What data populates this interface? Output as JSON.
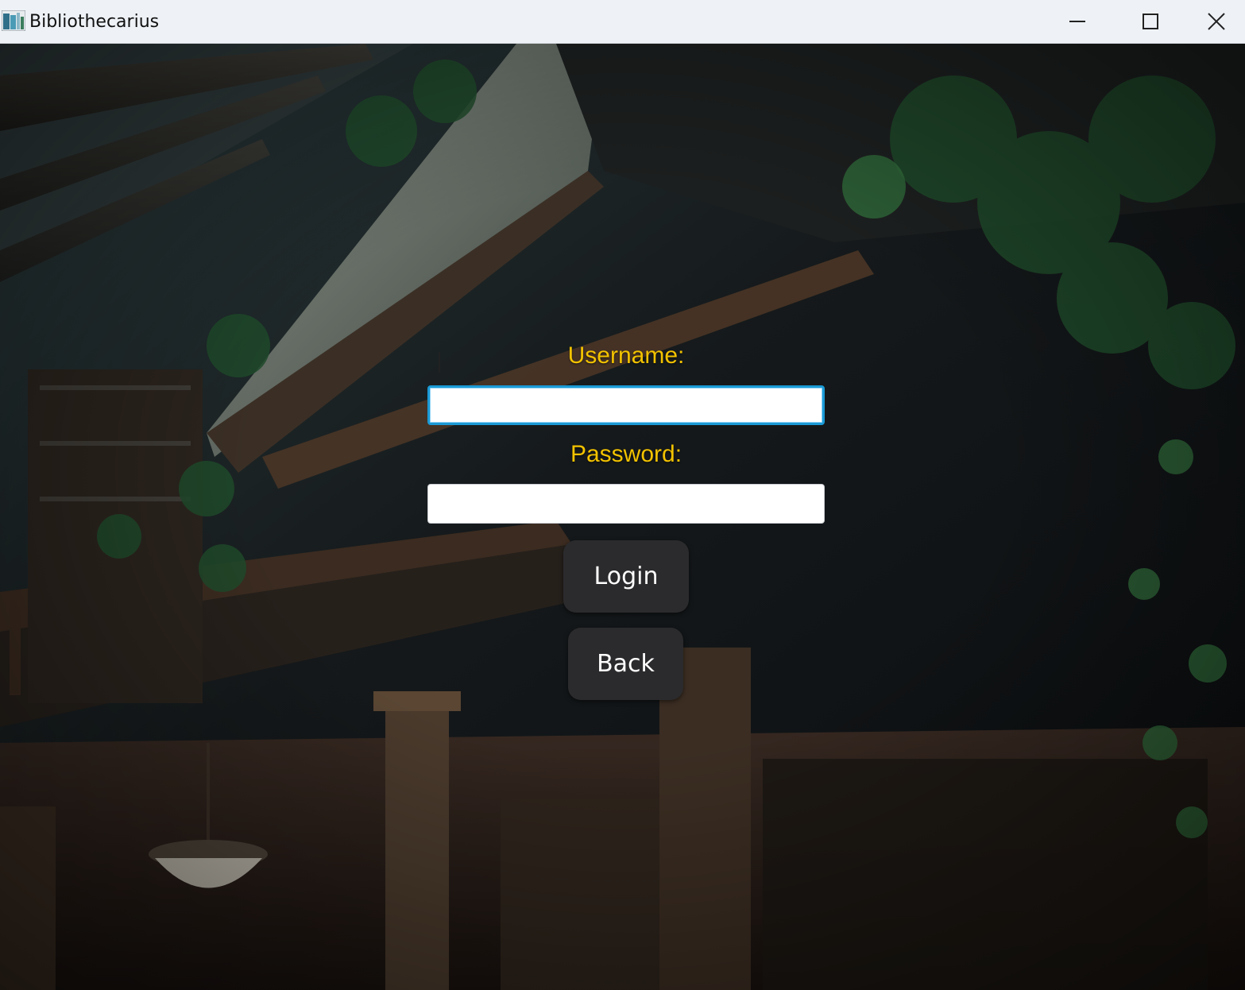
{
  "window": {
    "title": "Bibliothecarius",
    "icons": {
      "app": "app-icon",
      "minimize": "minimize-icon",
      "maximize": "maximize-icon",
      "close": "close-icon"
    }
  },
  "login": {
    "username_label": "Username:",
    "username_value": "",
    "password_label": "Password:",
    "password_value": "",
    "login_button": "Login",
    "back_button": "Back"
  },
  "colors": {
    "label": "#f2c200",
    "focus_border": "#1b9ad6",
    "button_bg": "#2b2b2d",
    "titlebar_bg": "#eef2f7"
  }
}
